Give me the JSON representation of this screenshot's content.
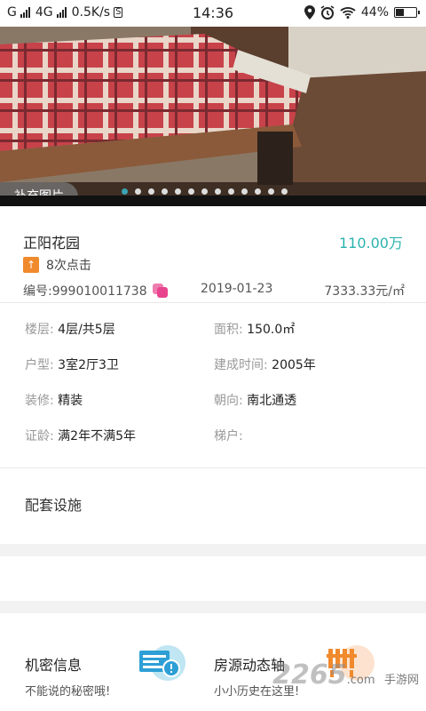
{
  "status_bar": {
    "carrier_left": "G",
    "network": "4G",
    "speed": "0.5K/s",
    "s_icon": "S",
    "time": "14:36",
    "battery": "44%",
    "battery_level": 0.44,
    "icons": [
      "signal-icon",
      "location-icon",
      "alarm-icon",
      "wifi-icon",
      "battery-icon"
    ]
  },
  "gallery": {
    "supplement_label": "补充图片",
    "image_count": 13,
    "active_index": 0,
    "accent": "#3aa3b5"
  },
  "listing": {
    "name": "正阳花园",
    "price": "110.00万",
    "price_color": "#2bb3ad",
    "clicks": "8次点击",
    "clicks_badge": "↑",
    "code": "编号:999010011738",
    "date": "2019-01-23",
    "unit_price": "7333.33元/㎡"
  },
  "details": [
    [
      {
        "label": "楼层:",
        "value": "4层/共5层"
      },
      {
        "label": "面积:",
        "value": "150.0㎡"
      }
    ],
    [
      {
        "label": "户型:",
        "value": "3室2厅3卫"
      },
      {
        "label": "建成时间:",
        "value": "2005年"
      }
    ],
    [
      {
        "label": "装修:",
        "value": "精装"
      },
      {
        "label": "朝向:",
        "value": "南北通透"
      }
    ],
    [
      {
        "label": "证龄:",
        "value": "满2年不满5年"
      },
      {
        "label": "梯户:",
        "value": ""
      }
    ]
  ],
  "facilities_title": "配套设施",
  "cards": {
    "secret": {
      "title": "机密信息",
      "subtitle": "不能说的秘密哦!",
      "icon": "secret-info-icon"
    },
    "timeline": {
      "title": "房源动态轴",
      "subtitle": "小小历史在这里!",
      "icon": "timeline-icon"
    }
  },
  "watermark": {
    "main": "2265",
    "sub": "手游网",
    "domain": ".com"
  }
}
